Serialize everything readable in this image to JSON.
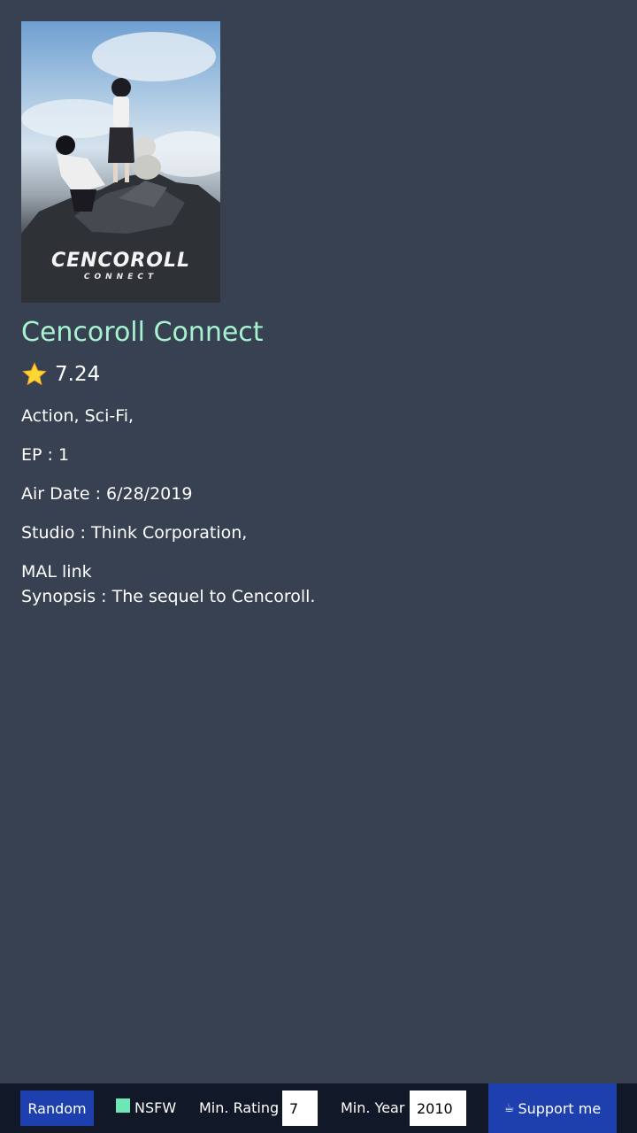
{
  "anime": {
    "poster_title": "CENCOROLL",
    "poster_subtitle": "CONNECT",
    "title": "Cencoroll Connect",
    "rating": "7.24",
    "genres": "Action, Sci-Fi,",
    "episodes": "EP : 1",
    "air_date": "Air Date : 6/28/2019",
    "studio": "Studio : Think Corporation,",
    "mal_link": "MAL link",
    "synopsis": "Synopsis : The sequel to Cencoroll."
  },
  "bottom_bar": {
    "random_label": "Random",
    "nsfw_label": "NSFW",
    "min_rating_label": "Min. Rating",
    "min_rating_value": "7",
    "min_year_label": "Min. Year",
    "min_year_value": "2010",
    "support_label": "Support me",
    "support_icon": "coffee-icon"
  },
  "colors": {
    "background": "#374151",
    "title": "#a7f3d0",
    "button": "#1e40af",
    "bar": "#111827",
    "checkbox": "#6ee7b7"
  }
}
